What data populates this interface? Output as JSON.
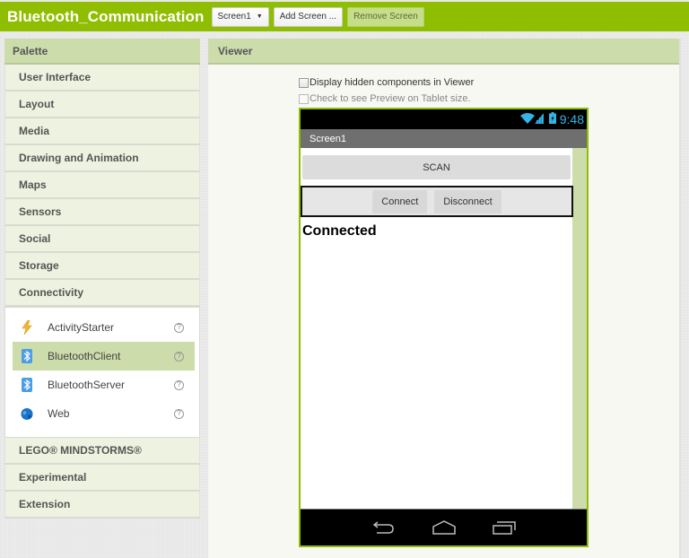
{
  "topbar": {
    "project_title": "Bluetooth_Communication",
    "screen_selector": "Screen1",
    "add_screen_label": "Add Screen ...",
    "remove_screen_label": "Remove Screen",
    "accent_color": "#8fbe00"
  },
  "palette": {
    "header": "Palette",
    "categories_before": [
      {
        "label": "User Interface"
      },
      {
        "label": "Layout"
      },
      {
        "label": "Media"
      },
      {
        "label": "Drawing and Animation"
      },
      {
        "label": "Maps"
      },
      {
        "label": "Sensors"
      },
      {
        "label": "Social"
      },
      {
        "label": "Storage"
      },
      {
        "label": "Connectivity"
      }
    ],
    "expanded_category": "Connectivity",
    "components": [
      {
        "label": "ActivityStarter",
        "icon": "lightning-icon",
        "help": "?"
      },
      {
        "label": "BluetoothClient",
        "icon": "bluetooth-icon",
        "help": "?",
        "selected": true
      },
      {
        "label": "BluetoothServer",
        "icon": "bluetooth-icon",
        "help": "?"
      },
      {
        "label": "Web",
        "icon": "globe-icon",
        "help": "?"
      }
    ],
    "categories_after": [
      {
        "label": "LEGO® MINDSTORMS®"
      },
      {
        "label": "Experimental"
      },
      {
        "label": "Extension"
      }
    ]
  },
  "viewer": {
    "header": "Viewer",
    "display_hidden_label": "Display hidden components in Viewer",
    "display_hidden_checked": false,
    "tablet_preview_label": "Check to see Preview on Tablet size.",
    "tablet_preview_checked": false,
    "phone": {
      "status_time": "9:48",
      "screen_title": "Screen1",
      "scan_button": "SCAN",
      "connect_button": "Connect",
      "disconnect_button": "Disconnect",
      "status_label": "Connected"
    }
  }
}
